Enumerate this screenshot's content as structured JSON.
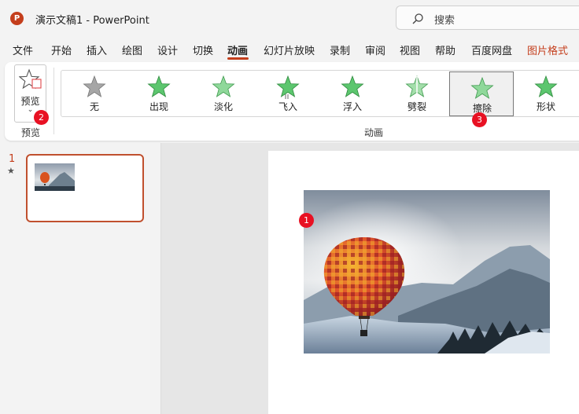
{
  "window": {
    "app_icon_letter": "P",
    "title": "演示文稿1  -  PowerPoint",
    "search_placeholder": "搜索"
  },
  "ribbon_tabs": [
    "文件",
    "开始",
    "插入",
    "绘图",
    "设计",
    "切换",
    "动画",
    "幻灯片放映",
    "录制",
    "审阅",
    "视图",
    "帮助",
    "百度网盘",
    "图片格式"
  ],
  "active_tab": "动画",
  "preview_group": {
    "button_label": "预览",
    "group_label": "预览"
  },
  "animation_group": {
    "label": "动画",
    "effects": [
      "无",
      "出现",
      "淡化",
      "飞入",
      "浮入",
      "劈裂",
      "擦除",
      "形状"
    ],
    "selected": "擦除"
  },
  "badges": {
    "preview": "2",
    "wipe": "3",
    "picture": "1"
  },
  "slides": [
    {
      "number": "1",
      "has_animation_mark": "★"
    }
  ],
  "colors": {
    "accent": "#c43e1c",
    "badge": "#e81123",
    "star_green": "#5cc66e"
  }
}
